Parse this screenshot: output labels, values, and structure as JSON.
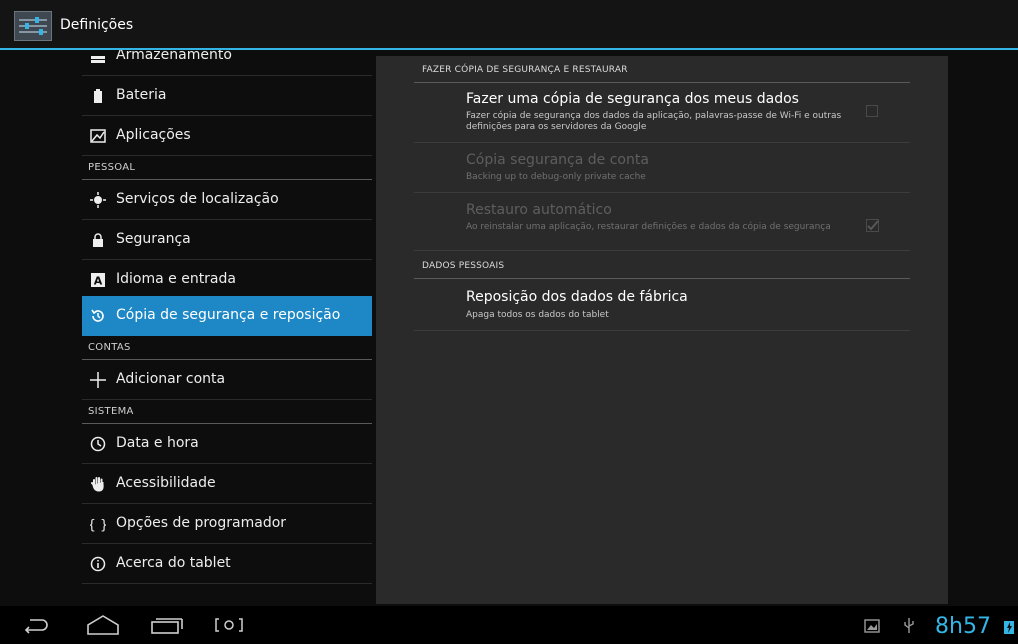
{
  "app": {
    "title": "Definições"
  },
  "sidebar": {
    "items": [
      {
        "label": "Armazenamento",
        "icon": "storage-icon"
      },
      {
        "label": "Bateria",
        "icon": "battery-icon"
      },
      {
        "label": "Aplicações",
        "icon": "apps-icon"
      },
      {
        "section": "PESSOAL"
      },
      {
        "label": "Serviços de localização",
        "icon": "location-icon"
      },
      {
        "label": "Segurança",
        "icon": "lock-icon"
      },
      {
        "label": "Idioma e entrada",
        "icon": "language-icon"
      },
      {
        "label": "Cópia de segurança e reposição",
        "icon": "backup-icon",
        "selected": true
      },
      {
        "section": "CONTAS"
      },
      {
        "label": "Adicionar conta",
        "icon": "plus-icon"
      },
      {
        "section": "SISTEMA"
      },
      {
        "label": "Data e hora",
        "icon": "clock-icon"
      },
      {
        "label": "Acessibilidade",
        "icon": "hand-icon"
      },
      {
        "label": "Opções de programador",
        "icon": "braces-icon"
      },
      {
        "label": "Acerca do tablet",
        "icon": "info-icon"
      }
    ]
  },
  "main": {
    "section_backup": "FAZER CÓPIA DE SEGURANÇA E RESTAURAR",
    "prefs": [
      {
        "title": "Fazer uma cópia de segurança dos meus dados",
        "summary": "Fazer cópia de segurança dos dados da aplicação, palavras-passe de Wi-Fi e outras definições para os servidores da Google",
        "checked": false,
        "enabled": true
      },
      {
        "title": "Cópia segurança de conta",
        "summary": "Backing up to debug-only private cache",
        "enabled": false
      },
      {
        "title": "Restauro automático",
        "summary": "Ao reinstalar uma aplicação, restaurar definições e dados da cópia de segurança",
        "checked": true,
        "enabled": false
      }
    ],
    "section_personal": "DADOS PESSOAIS",
    "factory_reset": {
      "title": "Reposição dos dados de fábrica",
      "summary": "Apaga todos os dados do tablet"
    }
  },
  "navbar": {
    "clock": "8h57"
  },
  "colors": {
    "accent": "#33b5e5",
    "selected": "#1e88c6"
  }
}
